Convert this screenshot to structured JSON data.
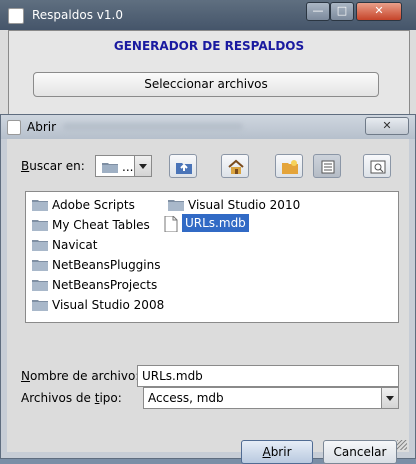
{
  "outer": {
    "title": "Respaldos v1.0",
    "heading": "GENERADOR DE RESPALDOS",
    "select_button": "Seleccionar archivos",
    "min_glyph": "—",
    "max_glyph": "□",
    "close_glyph": "✕"
  },
  "dialog": {
    "title": "Abrir",
    "close_glyph": "✕",
    "look_in_label": "Buscar en:",
    "look_in_mnemonic": "B",
    "look_in_rest": "uscar en:",
    "look_in_value": "...",
    "toolbar": {
      "up": "up-folder-icon",
      "home": "home-icon",
      "new_folder": "new-folder-icon",
      "list": "list-view-icon",
      "details": "details-view-icon"
    },
    "files": [
      {
        "name": "Adobe Scripts",
        "type": "folder"
      },
      {
        "name": "My Cheat Tables",
        "type": "folder"
      },
      {
        "name": "Navicat",
        "type": "folder"
      },
      {
        "name": "NetBeansPluggins",
        "type": "folder"
      },
      {
        "name": "NetBeansProjects",
        "type": "folder"
      },
      {
        "name": "Visual Studio 2008",
        "type": "folder"
      },
      {
        "name": "Visual Studio 2010",
        "type": "folder"
      },
      {
        "name": "URLs.mdb",
        "type": "file",
        "selected": true
      }
    ],
    "file_name_label_mnemonic": "N",
    "file_name_label_rest": "ombre de archivo:",
    "file_name_value": "URLs.mdb",
    "file_type_label_pre": "Archivos de ",
    "file_type_label_mnemonic": "t",
    "file_type_label_post": "ipo:",
    "file_type_value": "Access, mdb",
    "open_button_mnemonic": "A",
    "open_button_rest": "brir",
    "cancel_button": "Cancelar"
  },
  "colors": {
    "heading": "#1a1aa0",
    "selection": "#316ac5",
    "folder": "#7f8fa3"
  }
}
